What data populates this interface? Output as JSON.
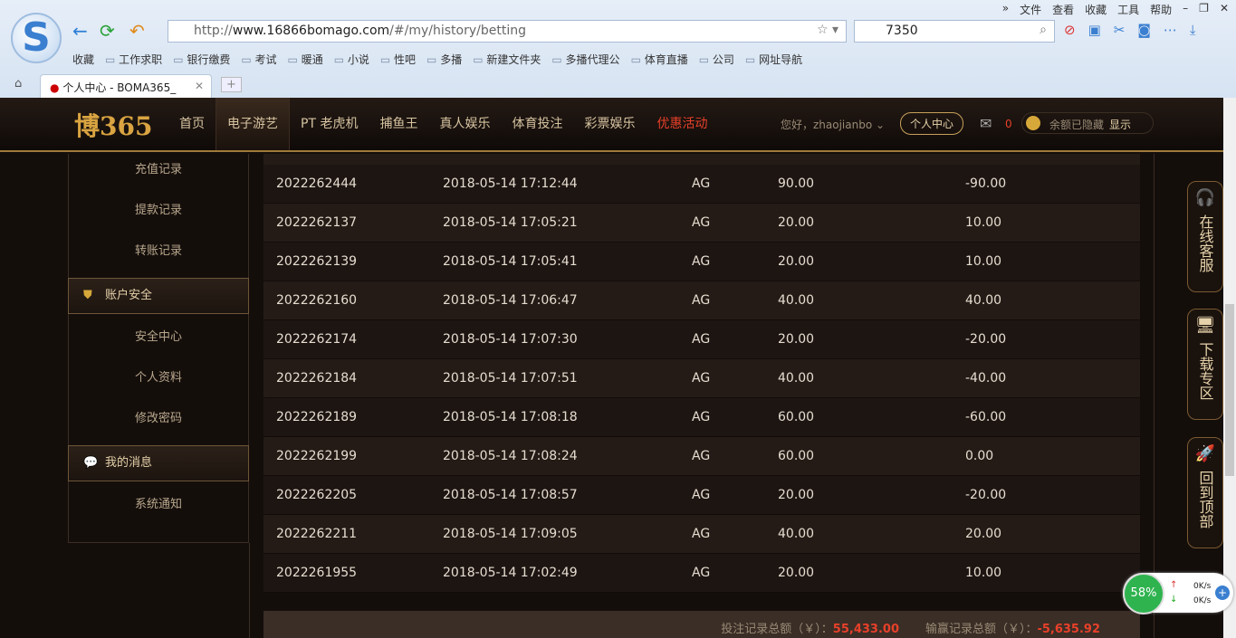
{
  "browser": {
    "menu": [
      "»",
      "文件",
      "查看",
      "收藏",
      "工具",
      "帮助"
    ],
    "url_prefix": "http://",
    "url_host": "www.16866bomago.com",
    "url_path": "/#/my/history/betting",
    "search_value": "7350",
    "favorites_label": "收藏",
    "bookmarks": [
      "工作求职",
      "银行缴费",
      "考试",
      "暖通",
      "小说",
      "性吧",
      "多播",
      "新建文件夹",
      "多播代理公",
      "体育直播",
      "公司",
      "网址导航"
    ],
    "tab_title": "个人中心 - BOMA365_"
  },
  "site": {
    "logo": "博365",
    "nav": [
      "首页",
      "电子游艺",
      "PT 老虎机",
      "捕鱼王",
      "真人娱乐",
      "体育投注",
      "彩票娱乐",
      "优惠活动"
    ],
    "greeting": "您好，zhaojianbo",
    "personal_center": "个人中心",
    "mail_count": "0",
    "balance_hidden": "余额已隐藏",
    "show": "显示"
  },
  "sidebar": {
    "items1": [
      "充值记录",
      "提款记录",
      "转账记录"
    ],
    "head1": "账户安全",
    "items2": [
      "安全中心",
      "个人资料",
      "修改密码"
    ],
    "head2": "我的消息",
    "items3": [
      "系统通知"
    ]
  },
  "rows": [
    [
      "2022262444",
      "2018-05-14 17:12:44",
      "AG",
      "90.00",
      "-90.00"
    ],
    [
      "2022262137",
      "2018-05-14 17:05:21",
      "AG",
      "20.00",
      "10.00"
    ],
    [
      "2022262139",
      "2018-05-14 17:05:41",
      "AG",
      "20.00",
      "10.00"
    ],
    [
      "2022262160",
      "2018-05-14 17:06:47",
      "AG",
      "40.00",
      "40.00"
    ],
    [
      "2022262174",
      "2018-05-14 17:07:30",
      "AG",
      "20.00",
      "-20.00"
    ],
    [
      "2022262184",
      "2018-05-14 17:07:51",
      "AG",
      "40.00",
      "-40.00"
    ],
    [
      "2022262189",
      "2018-05-14 17:08:18",
      "AG",
      "60.00",
      "-60.00"
    ],
    [
      "2022262199",
      "2018-05-14 17:08:24",
      "AG",
      "60.00",
      "0.00"
    ],
    [
      "2022262205",
      "2018-05-14 17:08:57",
      "AG",
      "20.00",
      "-20.00"
    ],
    [
      "2022262211",
      "2018-05-14 17:09:05",
      "AG",
      "40.00",
      "20.00"
    ],
    [
      "2022261955",
      "2018-05-14 17:02:49",
      "AG",
      "20.00",
      "10.00"
    ]
  ],
  "footer": {
    "bet_label": "投注记录总额（￥）：",
    "bet_total": "55,433.00",
    "win_label": "输赢记录总额（￥）：",
    "win_total": "-5,635.92"
  },
  "float": {
    "service": "在线客服",
    "download": "下载专区",
    "top": "回到顶部"
  },
  "speed": {
    "percent": "58%",
    "up": "0K/s",
    "down": "0K/s"
  }
}
